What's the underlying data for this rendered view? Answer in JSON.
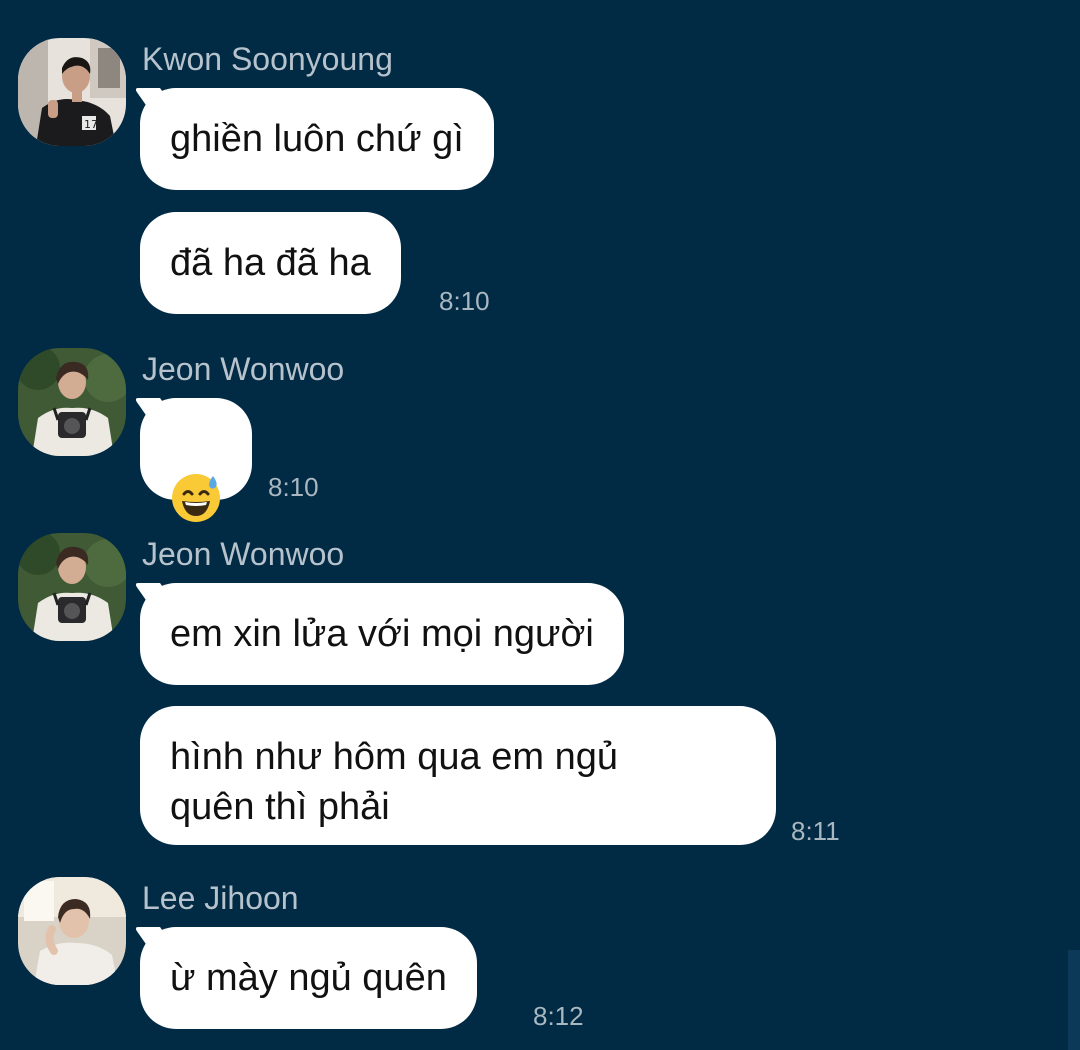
{
  "messages": [
    {
      "sender": "Kwon Soonyoung",
      "avatar": "avatar-kwon-soonyoung",
      "bubbles": [
        "ghiền luôn chứ gì",
        "đã ha đã ha"
      ],
      "time": "8:10"
    },
    {
      "sender": "Jeon Wonwoo",
      "avatar": "avatar-jeon-wonwoo",
      "bubbles": [
        "grinning-sweat-emoji"
      ],
      "time": "8:10"
    },
    {
      "sender": "Jeon Wonwoo",
      "avatar": "avatar-jeon-wonwoo",
      "bubbles": [
        "em xin lửa với mọi người",
        "hình như hôm qua em ngủ\nquên thì phải"
      ],
      "time": "8:11"
    },
    {
      "sender": "Lee Jihoon",
      "avatar": "avatar-lee-jihoon",
      "bubbles": [
        "ừ mày ngủ quên"
      ],
      "time": "8:12"
    }
  ],
  "colors": {
    "background": "#012a44",
    "bubble": "#ffffff",
    "sender_text": "#b7c3cc",
    "time_text": "#a9b7c1"
  }
}
